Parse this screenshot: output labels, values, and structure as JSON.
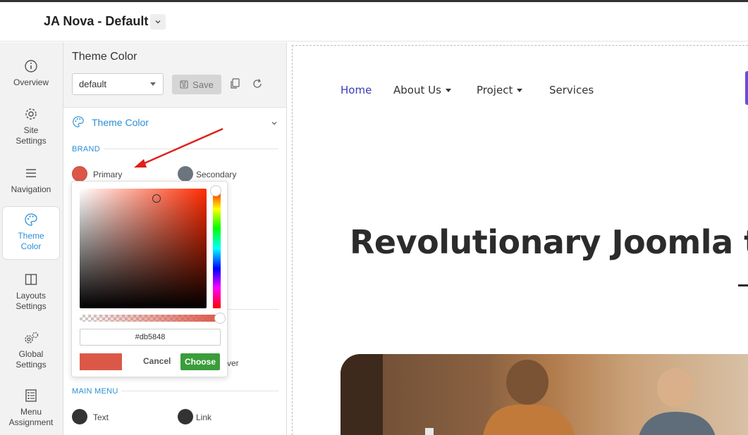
{
  "header": {
    "title": "JA Nova - Default"
  },
  "sidebar": {
    "items": [
      {
        "label": "Overview",
        "icon": "info-icon"
      },
      {
        "label": "Site Settings",
        "icon": "gear-icon"
      },
      {
        "label": "Navigation",
        "icon": "hamburger-icon"
      },
      {
        "label": "Theme Color",
        "icon": "palette-icon",
        "active": true
      },
      {
        "label": "Layouts Settings",
        "icon": "layout-icon"
      },
      {
        "label": "Global Settings",
        "icon": "gears-icon"
      },
      {
        "label": "Menu Assignment",
        "icon": "list-icon"
      }
    ]
  },
  "panel": {
    "title": "Theme Color",
    "preset": "default",
    "save_label": "Save",
    "section_title": "Theme Color",
    "brand_label": "BRAND",
    "primary_label": "Primary",
    "secondary_label": "Secondary",
    "hover_label_partial": "ver",
    "main_menu_label": "MAIN MENU",
    "text_label": "Text",
    "link_label": "Link",
    "colors": {
      "primary": "#db5848",
      "secondary": "#6c757d",
      "text": "#333333",
      "link": "#333333"
    }
  },
  "picker": {
    "hex": "#db5848",
    "cancel_label": "Cancel",
    "choose_label": "Choose",
    "hue_color": "#ff2a00"
  },
  "preview": {
    "nav": [
      "Home",
      "About Us",
      "Project",
      "Services"
    ],
    "hero_title": "Revolutionary Joomla te"
  }
}
